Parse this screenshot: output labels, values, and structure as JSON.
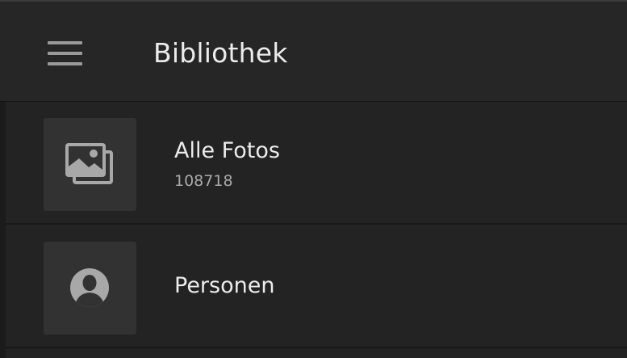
{
  "header": {
    "title": "Bibliothek",
    "menu_icon": "hamburger-menu-icon"
  },
  "library": {
    "items": [
      {
        "label": "Alle Fotos",
        "count": "108718",
        "icon": "photos-stack-icon"
      },
      {
        "label": "Personen",
        "count": "",
        "icon": "person-icon"
      }
    ]
  },
  "colors": {
    "background": "#232323",
    "header_background": "#262626",
    "thumb_background": "#323232",
    "icon": "#a8a8a8",
    "text_primary": "#ececec",
    "text_secondary": "#a9a9a9"
  }
}
